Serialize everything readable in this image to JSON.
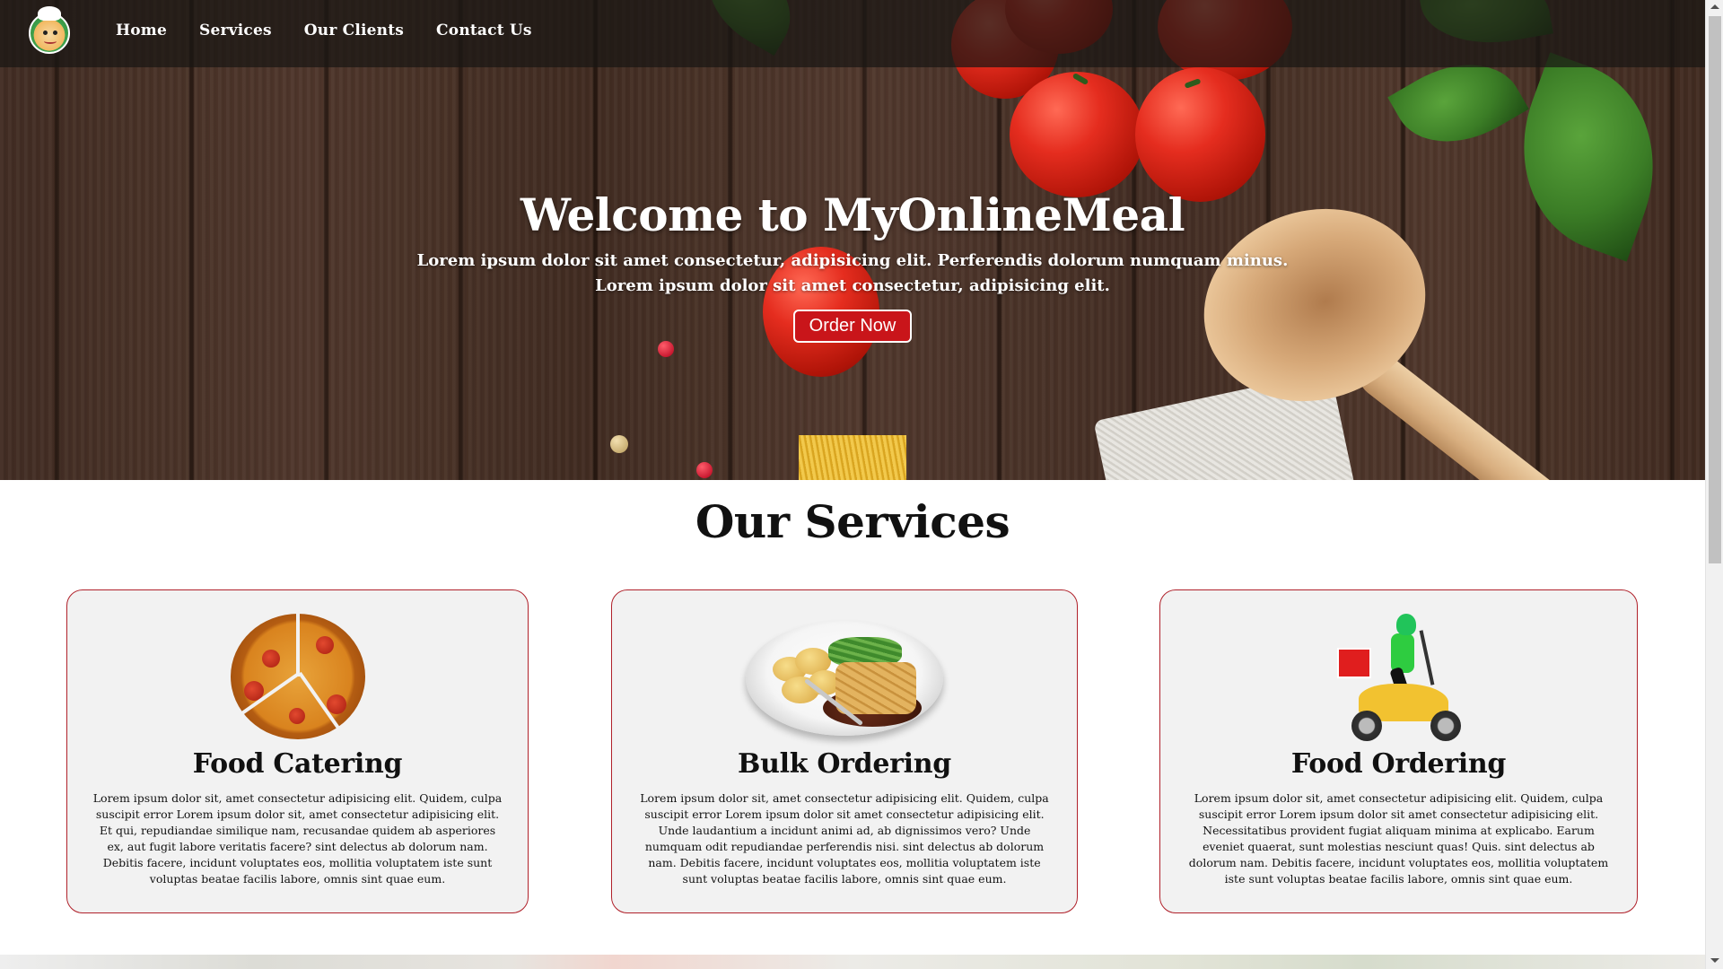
{
  "nav": {
    "logo_icon": "chef-mascot-icon",
    "links": [
      "Home",
      "Services",
      "Our Clients",
      "Contact Us"
    ]
  },
  "hero": {
    "title": "Welcome to MyOnlineMeal",
    "subtitle_line1": "Lorem ipsum dolor sit amet consectetur, adipisicing elit. Perferendis dolorum numquam minus.",
    "subtitle_line2": "Lorem ipsum dolor sit amet consectetur, adipisicing elit.",
    "cta_label": "Order Now"
  },
  "services": {
    "heading": "Our Services",
    "cards": [
      {
        "title": "Food Catering",
        "image_icon": "pizza-icon",
        "text": "Lorem ipsum dolor sit, amet consectetur adipisicing elit. Quidem, culpa suscipit error Lorem ipsum dolor sit, amet consectetur adipisicing elit. Et qui, repudiandae similique nam, recusandae quidem ab asperiores ex, aut fugit labore veritatis facere? sint delectus ab dolorum nam. Debitis facere, incidunt voluptates eos, mollitia voluptatem iste sunt voluptas beatae facilis labore, omnis sint quae eum."
      },
      {
        "title": "Bulk Ordering",
        "image_icon": "meal-plate-icon",
        "text": "Lorem ipsum dolor sit, amet consectetur adipisicing elit. Quidem, culpa suscipit error Lorem ipsum dolor sit amet consectetur adipisicing elit. Unde laudantium a incidunt animi ad, ab dignissimos vero? Unde numquam odit repudiandae perferendis nisi. sint delectus ab dolorum nam. Debitis facere, incidunt voluptates eos, mollitia voluptatem iste sunt voluptas beatae facilis labore, omnis sint quae eum."
      },
      {
        "title": "Food Ordering",
        "image_icon": "delivery-scooter-icon",
        "text": "Lorem ipsum dolor sit, amet consectetur adipisicing elit. Quidem, culpa suscipit error Lorem ipsum dolor sit amet consectetur adipisicing elit. Necessitatibus provident fugiat aliquam minima at explicabo. Earum eveniet quaerat, sunt molestias nesciunt quas! Quis. sint delectus ab dolorum nam. Debitis facere, incidunt voluptates eos, mollitia voluptatem iste sunt voluptas beatae facilis labore, omnis sint quae eum."
      }
    ]
  },
  "colors": {
    "accent": "#c9151a",
    "card_border": "#b0222b",
    "card_bg": "#f2f2f2",
    "nav_bg": "#191614"
  }
}
